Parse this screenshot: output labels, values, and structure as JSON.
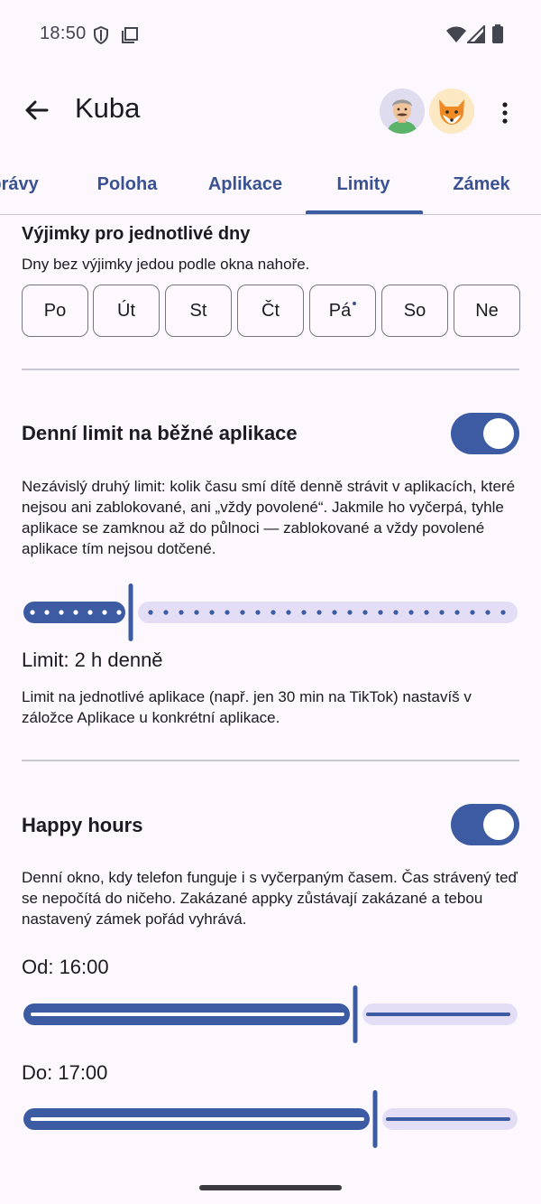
{
  "status_bar": {
    "time": "18:50"
  },
  "app_bar": {
    "title": "Kuba"
  },
  "tabs": [
    {
      "label": "Zprávy"
    },
    {
      "label": "Poloha"
    },
    {
      "label": "Aplikace"
    },
    {
      "label": "Limity"
    },
    {
      "label": "Zámek"
    }
  ],
  "selected_tab": "Limity",
  "exceptions": {
    "title": "Výjimky pro jednotlivé dny",
    "subtitle": "Dny bez výjimky jedou podle okna nahoře.",
    "days": [
      {
        "label": "Po"
      },
      {
        "label": "Út"
      },
      {
        "label": "St"
      },
      {
        "label": "Čt"
      },
      {
        "label": "Pá",
        "has_exception": true
      },
      {
        "label": "So"
      },
      {
        "label": "Ne"
      }
    ]
  },
  "daily_limit": {
    "title": "Denní limit na běžné aplikace",
    "enabled": true,
    "description": "Nezávislý druhý limit: kolik času smí dítě denně strávit v aplikacích, které nejsou ani zablokované, ani „vždy povolené“. Jakmile ho vyčerpá, tyhle aplikace se zamknou až do půlnoci — zablokované a vždy povolené aplikace tím nejsou dotčené.",
    "slider_fraction": 0.22,
    "value_label": "Limit: 2 h denně",
    "note": "Limit na jednotlivé aplikace (např. jen 30 min na TikTok) nastavíš v záložce Aplikace u konkrétní aplikace."
  },
  "happy_hours": {
    "title": "Happy hours",
    "enabled": true,
    "description": "Denní okno, kdy telefon funguje i s vyčerpaným časem. Čas strávený teď se nepočítá do ničeho. Zakázané appky zůstávají zakázané a tebou nastavený zámek pořád vyhrává.",
    "from_label": "Od: 16:00",
    "from_fraction": 0.67,
    "to_label": "Do: 17:00",
    "to_fraction": 0.71
  },
  "colors": {
    "accent": "#3d5ba3",
    "track_inactive": "#e3def6",
    "background": "#fcf8fd"
  }
}
